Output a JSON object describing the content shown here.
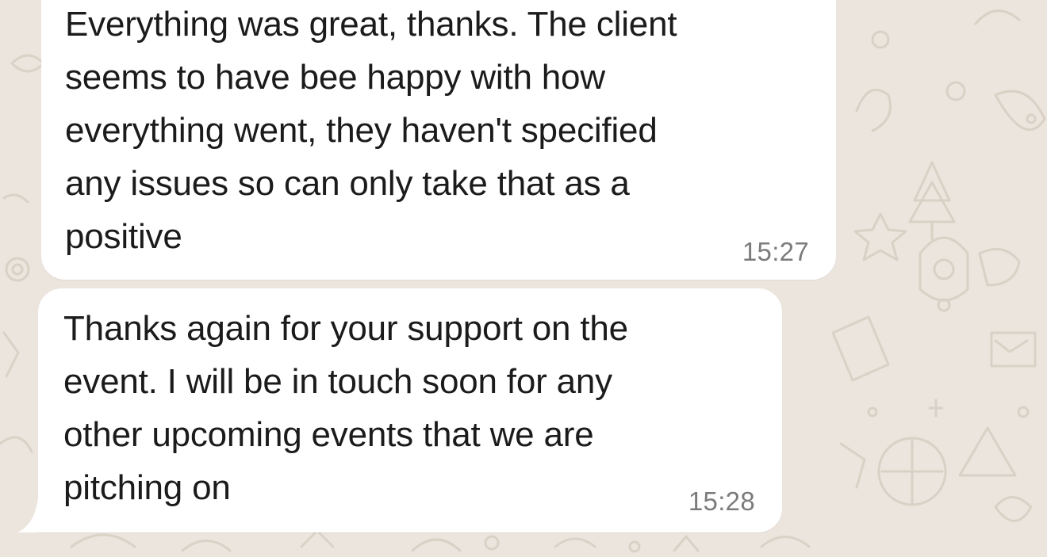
{
  "conversation": {
    "wallpaper_color": "#ece5dd",
    "bubble_color": "#ffffff",
    "messages": [
      {
        "lines": [
          "Everything was great, thanks. The client",
          "seems to have bee happy with how",
          "everything went, they haven't specified",
          "any issues so can only take that as a",
          "positive"
        ],
        "time": "15:27"
      },
      {
        "lines": [
          "Thanks again for your support on the",
          "event. I will be in touch soon for any",
          "other upcoming events that we are",
          "pitching on"
        ],
        "time": "15:28"
      }
    ]
  }
}
